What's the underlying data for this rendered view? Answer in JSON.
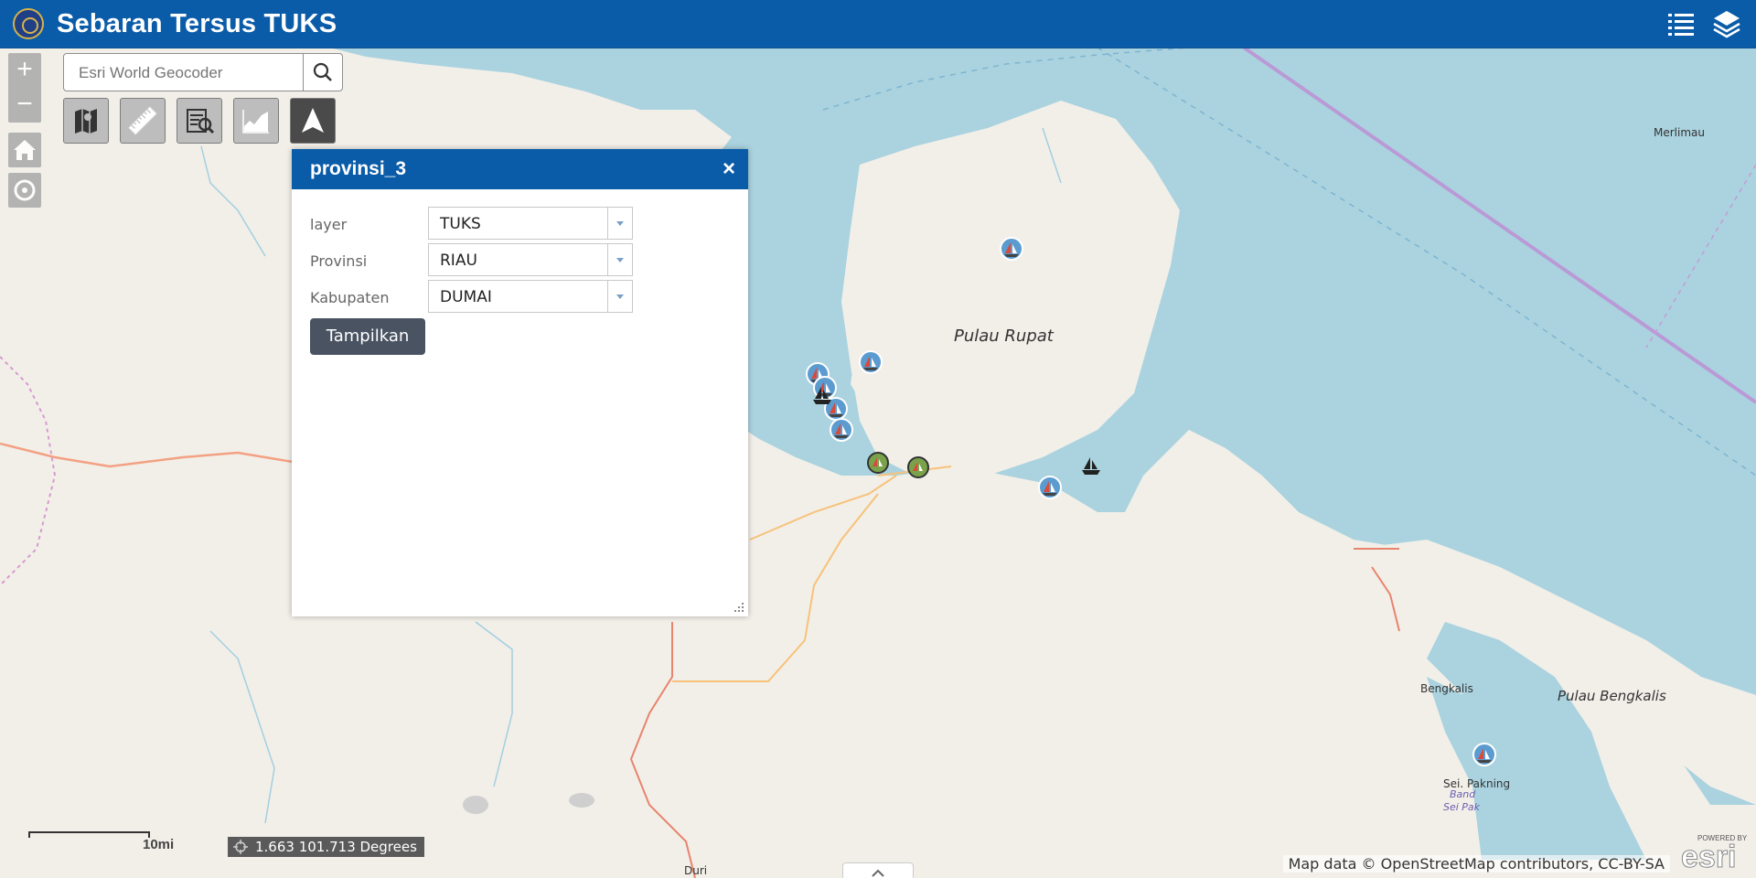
{
  "header": {
    "title": "Sebaran Tersus TUKS",
    "logo_icon": "ministry-emblem-icon",
    "buttons": [
      {
        "name": "legend",
        "icon": "list-icon"
      },
      {
        "name": "layers",
        "icon": "layers-icon"
      }
    ],
    "color": "#0b5ca8"
  },
  "map_controls": {
    "zoom_in": "+",
    "zoom_out": "−",
    "home_icon": "home-icon",
    "locate_icon": "locate-icon"
  },
  "search": {
    "placeholder": "Esri World Geocoder",
    "button_icon": "search-icon"
  },
  "toolbar": [
    {
      "name": "basemap",
      "icon": "map-icon",
      "active": false
    },
    {
      "name": "measure",
      "icon": "ruler-icon",
      "active": false
    },
    {
      "name": "query",
      "icon": "query-icon",
      "active": false
    },
    {
      "name": "elevation",
      "icon": "chart-icon",
      "active": false
    },
    {
      "name": "navigate",
      "icon": "navigation-arrow-icon",
      "active": true
    }
  ],
  "panel": {
    "title": "provinsi_3",
    "close": "×",
    "fields": [
      {
        "label": "layer",
        "value": "TUKS"
      },
      {
        "label": "Provinsi",
        "value": "RIAU"
      },
      {
        "label": "Kabupaten",
        "value": "DUMAI"
      }
    ],
    "submit_label": "Tampilkan"
  },
  "map": {
    "labels": {
      "pulau_rupat": "Pulau Rupat",
      "pulau_bengkalis": "Pulau Bengkalis",
      "bengkalis": "Bengkalis",
      "sei_pakning": "Sei. Pakning",
      "bandar_sei_pakning_1": "Band",
      "bandar_sei_pakning_2": "Sei Pak",
      "merlimau": "Merlimau",
      "duri": "Duri"
    },
    "markers": [
      {
        "type": "sailboat"
      },
      {
        "type": "sailboat"
      },
      {
        "type": "sailboat"
      },
      {
        "type": "sailboat"
      },
      {
        "type": "sailboat"
      },
      {
        "type": "sailboat"
      },
      {
        "type": "sailboat"
      },
      {
        "type": "sailboat"
      },
      {
        "type": "ferry"
      },
      {
        "type": "ferry"
      },
      {
        "type": "port"
      },
      {
        "type": "port"
      }
    ],
    "water_color": "#aad3df",
    "land_color": "#f2efe9"
  },
  "footer": {
    "scale_label": "10mi",
    "coordinates": "1.663 101.713 Degrees",
    "attribution": "Map data © OpenStreetMap contributors, CC-BY-SA",
    "esri_powered": "POWERED BY",
    "esri_logo": "esri"
  }
}
